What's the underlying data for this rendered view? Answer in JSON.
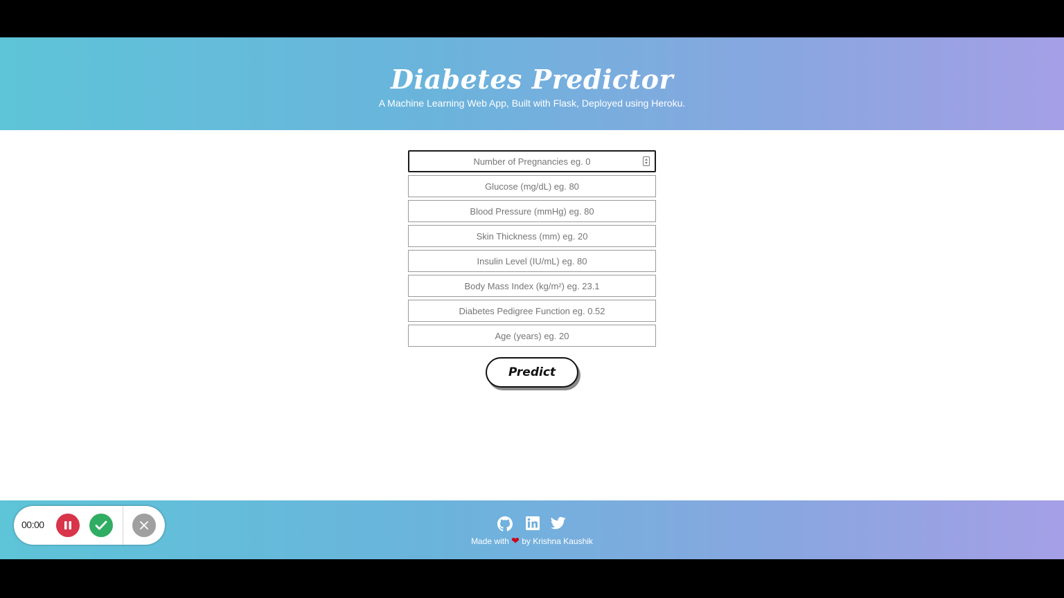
{
  "header": {
    "title": "Diabetes Predictor",
    "subtitle": "A Machine Learning Web App, Built with Flask, Deployed using Heroku."
  },
  "form": {
    "fields": [
      {
        "placeholder": "Number of Pregnancies eg. 0",
        "focused": true
      },
      {
        "placeholder": "Glucose (mg/dL) eg. 80"
      },
      {
        "placeholder": "Blood Pressure (mmHg) eg. 80"
      },
      {
        "placeholder": "Skin Thickness (mm) eg. 20"
      },
      {
        "placeholder": "Insulin Level (IU/mL) eg. 80"
      },
      {
        "placeholder": "Body Mass Index (kg/m²) eg. 23.1"
      },
      {
        "placeholder": "Diabetes Pedigree Function eg. 0.52"
      },
      {
        "placeholder": "Age (years) eg. 20"
      }
    ],
    "submit_label": "Predict"
  },
  "footer": {
    "social_icons": [
      "github-icon",
      "linkedin-icon",
      "twitter-icon"
    ],
    "made_with_prefix": "Made with",
    "made_with_suffix": "by Krishna Kaushik"
  },
  "recorder": {
    "time": "00:00",
    "icons": [
      "pause-icon",
      "check-icon",
      "close-icon"
    ]
  },
  "colors": {
    "gradient_start": "#5ec4d8",
    "gradient_end": "#a59fe6",
    "heart": "#d0021b",
    "pause": "#d8344a",
    "done": "#2fad62"
  }
}
